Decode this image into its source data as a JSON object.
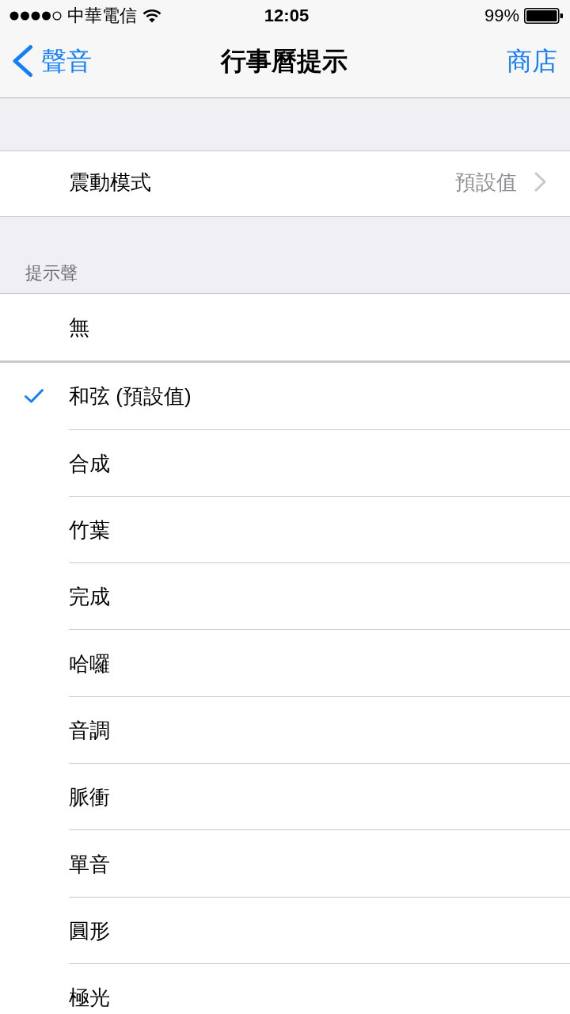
{
  "status_bar": {
    "carrier": "中華電信",
    "time": "12:05",
    "battery": "99%"
  },
  "nav_bar": {
    "back": "聲音",
    "title": "行事曆提示",
    "action": "商店"
  },
  "vibration": {
    "label": "震動模式",
    "value": "預設值"
  },
  "alert_tones": {
    "header": "提示聲",
    "groups": [
      {
        "items": [
          {
            "label": "無",
            "selected": false
          }
        ]
      },
      {
        "items": [
          {
            "label": "和弦 (預設值)",
            "selected": true
          },
          {
            "label": "合成",
            "selected": false
          },
          {
            "label": "竹葉",
            "selected": false
          },
          {
            "label": "完成",
            "selected": false
          },
          {
            "label": "哈囉",
            "selected": false
          },
          {
            "label": "音調",
            "selected": false
          },
          {
            "label": "脈衝",
            "selected": false
          },
          {
            "label": "單音",
            "selected": false
          },
          {
            "label": "圓形",
            "selected": false
          },
          {
            "label": "極光",
            "selected": false
          }
        ]
      }
    ]
  }
}
